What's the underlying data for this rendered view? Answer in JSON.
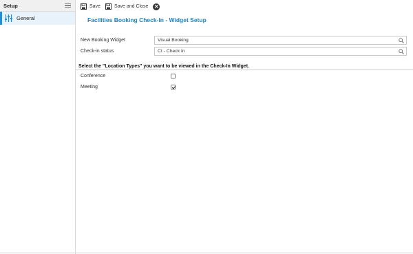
{
  "sidebar": {
    "title": "Setup",
    "items": [
      {
        "label": "General",
        "icon": "sliders-icon",
        "active": true
      }
    ]
  },
  "toolbar": {
    "save_label": "Save",
    "save_close_label": "Save and Close"
  },
  "page": {
    "title": "Facilities Booking Check-In - Widget Setup"
  },
  "form": {
    "new_booking_widget": {
      "label": "New Booking Widget",
      "value": "Visual Booking"
    },
    "checkin_status": {
      "label": "Check-in status",
      "value": "CI - Check In"
    }
  },
  "location_types": {
    "heading": "Select the \"Location Types\" you want to be viewed in the Check-In Widget.",
    "options": [
      {
        "label": "Conference",
        "checked": false
      },
      {
        "label": "Meeting",
        "checked": true
      }
    ]
  },
  "colors": {
    "accent": "#1b84c4",
    "active_bar": "#1d8fd6",
    "active_bg": "#e8f2fa"
  }
}
